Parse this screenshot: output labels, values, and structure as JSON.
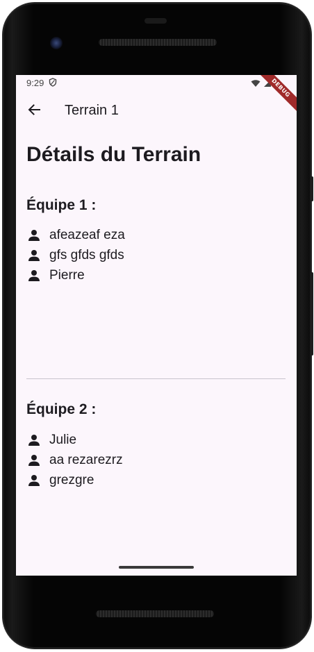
{
  "status_bar": {
    "time": "9:29",
    "debug_label": "DEBUG"
  },
  "app_bar": {
    "title": "Terrain 1",
    "back_icon": "arrow-back-icon"
  },
  "page": {
    "heading": "Détails du Terrain"
  },
  "teams": [
    {
      "title": "Équipe 1 :",
      "players": [
        "afeazeaf eza",
        "gfs gfds gfds",
        "Pierre"
      ]
    },
    {
      "title": "Équipe 2 :",
      "players": [
        "Julie",
        "aa rezarezrz",
        "grezgre"
      ]
    }
  ],
  "colors": {
    "background": "#fcf6fc",
    "text": "#1d1b20",
    "divider": "#c8c4cc",
    "debug_banner": "#a02a2a"
  }
}
